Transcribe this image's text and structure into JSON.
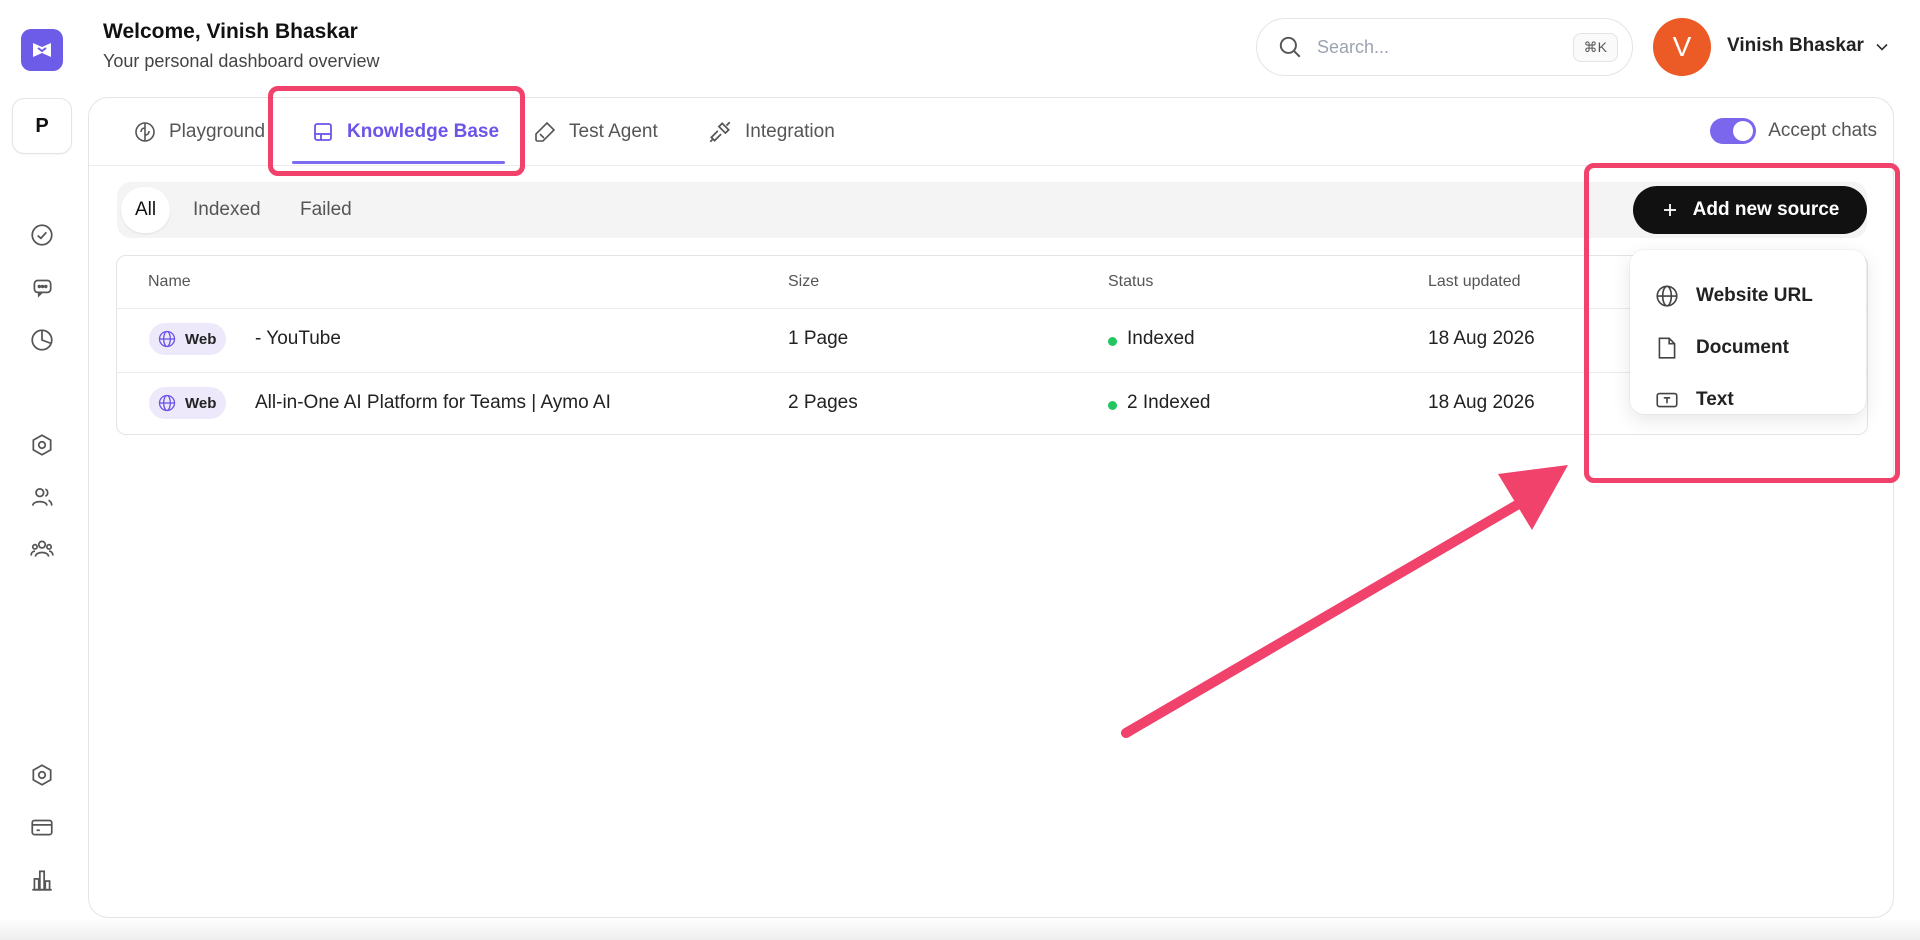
{
  "header": {
    "title": "Welcome, Vinish Bhaskar",
    "subtitle": "Your personal dashboard overview"
  },
  "search": {
    "placeholder": "Search...",
    "shortcut": "⌘K"
  },
  "user": {
    "avatar_initial": "V",
    "name": "Vinish Bhaskar",
    "avatar_color": "#ec5a25"
  },
  "workspace": {
    "initial": "P"
  },
  "tabs": [
    {
      "label": "Playground",
      "icon": "brain-icon"
    },
    {
      "label": "Knowledge Base",
      "icon": "book-icon",
      "active": true
    },
    {
      "label": "Test Agent",
      "icon": "flask-icon"
    },
    {
      "label": "Integration",
      "icon": "plug-icon"
    }
  ],
  "accept_chats": {
    "label": "Accept chats",
    "enabled": true
  },
  "filters": [
    "All",
    "Indexed",
    "Failed"
  ],
  "add_source": {
    "label": "Add new source",
    "options": [
      {
        "label": "Website URL",
        "icon": "globe-icon"
      },
      {
        "label": "Document",
        "icon": "document-icon"
      },
      {
        "label": "Text",
        "icon": "text-icon"
      }
    ]
  },
  "table": {
    "columns": [
      "Name",
      "Size",
      "Status",
      "Last updated"
    ],
    "rows": [
      {
        "type": "Web",
        "name": "- YouTube",
        "size": "1 Page",
        "status": "Indexed",
        "updated": "18 Aug 2026"
      },
      {
        "type": "Web",
        "name": "All-in-One AI Platform for Teams | Aymo AI",
        "size": "2 Pages",
        "status": "2 Indexed",
        "updated": "18 Aug 2026"
      }
    ]
  },
  "colors": {
    "accent": "#6b54e8",
    "annotation": "#f0426b",
    "status_ok": "#22c55e"
  }
}
